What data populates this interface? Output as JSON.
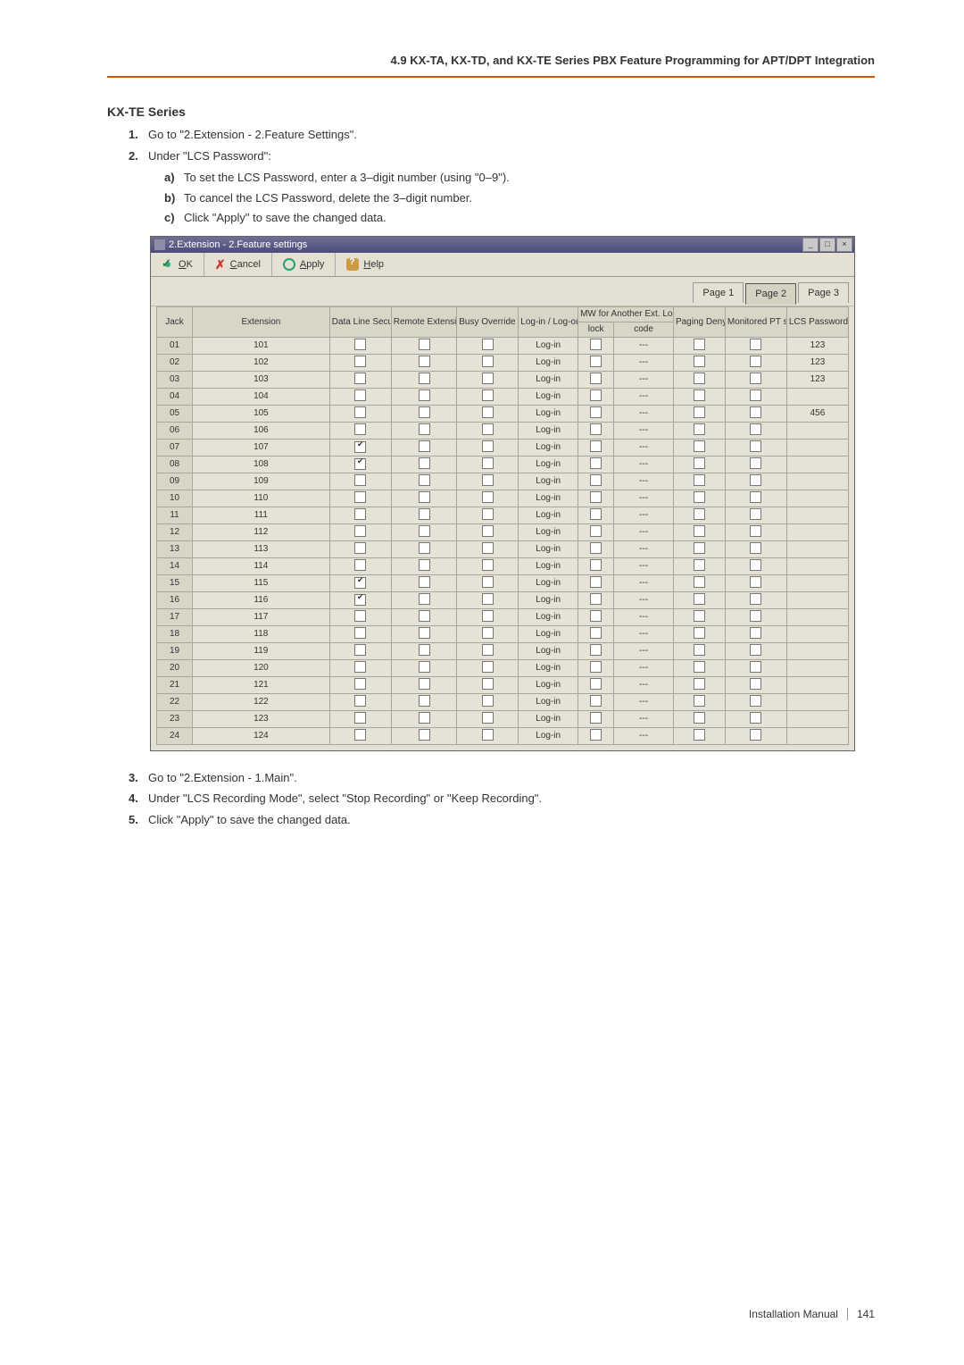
{
  "header": "4.9 KX-TA, KX-TD, and KX-TE Series PBX Feature Programming for APT/DPT Integration",
  "section_title": "KX-TE Series",
  "steps_top": [
    {
      "n": "1.",
      "t": "Go to \"2.Extension - 2.Feature Settings\"."
    },
    {
      "n": "2.",
      "t": "Under \"LCS Password\":"
    }
  ],
  "substeps": [
    {
      "n": "a)",
      "t": "To set the LCS Password, enter a 3–digit number (using \"0–9\")."
    },
    {
      "n": "b)",
      "t": "To cancel the LCS Password, delete the 3–digit number."
    },
    {
      "n": "c)",
      "t": "Click \"Apply\" to save the changed data."
    }
  ],
  "window": {
    "title": "2.Extension - 2.Feature settings",
    "toolbar": {
      "ok": "OK",
      "cancel": "Cancel",
      "apply": "Apply",
      "help": "Help",
      "ok_u": "O",
      "cancel_u": "C",
      "apply_u": "A",
      "help_u": "H"
    },
    "tabs": [
      "Page 1",
      "Page 2",
      "Page 3"
    ],
    "active_tab": 1,
    "columns": {
      "jack": "Jack",
      "ext": "Extension",
      "dls": "Data Line Security",
      "rel": "Remote Extension Lock",
      "bod": "Busy Override Deny",
      "login": "Log-in / Log-out",
      "mw": "MW for Another Ext. Lock",
      "mw_lock": "lock",
      "mw_code": "code",
      "pd": "Paging Deny",
      "mpt": "Monitored PT set",
      "lcs": "LCS Password"
    },
    "rows": [
      {
        "jack": "01",
        "ext": "101",
        "dls": false,
        "rel": false,
        "bod": false,
        "login": "Log-in",
        "mwl": false,
        "mwc": "---",
        "pd": false,
        "mpt": false,
        "lcs": "123"
      },
      {
        "jack": "02",
        "ext": "102",
        "dls": false,
        "rel": false,
        "bod": false,
        "login": "Log-in",
        "mwl": false,
        "mwc": "---",
        "pd": false,
        "mpt": false,
        "lcs": "123"
      },
      {
        "jack": "03",
        "ext": "103",
        "dls": false,
        "rel": false,
        "bod": false,
        "login": "Log-in",
        "mwl": false,
        "mwc": "---",
        "pd": false,
        "mpt": false,
        "lcs": "123"
      },
      {
        "jack": "04",
        "ext": "104",
        "dls": false,
        "rel": false,
        "bod": false,
        "login": "Log-in",
        "mwl": false,
        "mwc": "---",
        "pd": false,
        "mpt": false,
        "lcs": ""
      },
      {
        "jack": "05",
        "ext": "105",
        "dls": false,
        "rel": false,
        "bod": false,
        "login": "Log-in",
        "mwl": false,
        "mwc": "---",
        "pd": false,
        "mpt": false,
        "lcs": "456"
      },
      {
        "jack": "06",
        "ext": "106",
        "dls": false,
        "rel": false,
        "bod": false,
        "login": "Log-in",
        "mwl": false,
        "mwc": "---",
        "pd": false,
        "mpt": false,
        "lcs": ""
      },
      {
        "jack": "07",
        "ext": "107",
        "dls": true,
        "rel": false,
        "bod": false,
        "login": "Log-in",
        "mwl": false,
        "mwc": "---",
        "pd": false,
        "mpt": false,
        "lcs": ""
      },
      {
        "jack": "08",
        "ext": "108",
        "dls": true,
        "rel": false,
        "bod": false,
        "login": "Log-in",
        "mwl": false,
        "mwc": "---",
        "pd": false,
        "mpt": false,
        "lcs": ""
      },
      {
        "jack": "09",
        "ext": "109",
        "dls": false,
        "rel": false,
        "bod": false,
        "login": "Log-in",
        "mwl": false,
        "mwc": "---",
        "pd": false,
        "mpt": false,
        "lcs": ""
      },
      {
        "jack": "10",
        "ext": "110",
        "dls": false,
        "rel": false,
        "bod": false,
        "login": "Log-in",
        "mwl": false,
        "mwc": "---",
        "pd": false,
        "mpt": false,
        "lcs": ""
      },
      {
        "jack": "11",
        "ext": "111",
        "dls": false,
        "rel": false,
        "bod": false,
        "login": "Log-in",
        "mwl": false,
        "mwc": "---",
        "pd": false,
        "mpt": false,
        "lcs": ""
      },
      {
        "jack": "12",
        "ext": "112",
        "dls": false,
        "rel": false,
        "bod": false,
        "login": "Log-in",
        "mwl": false,
        "mwc": "---",
        "pd": false,
        "mpt": false,
        "lcs": ""
      },
      {
        "jack": "13",
        "ext": "113",
        "dls": false,
        "rel": false,
        "bod": false,
        "login": "Log-in",
        "mwl": false,
        "mwc": "---",
        "pd": false,
        "mpt": false,
        "lcs": ""
      },
      {
        "jack": "14",
        "ext": "114",
        "dls": false,
        "rel": false,
        "bod": false,
        "login": "Log-in",
        "mwl": false,
        "mwc": "---",
        "pd": false,
        "mpt": false,
        "lcs": ""
      },
      {
        "jack": "15",
        "ext": "115",
        "dls": true,
        "rel": false,
        "bod": false,
        "login": "Log-in",
        "mwl": false,
        "mwc": "---",
        "pd": false,
        "mpt": false,
        "lcs": ""
      },
      {
        "jack": "16",
        "ext": "116",
        "dls": true,
        "rel": false,
        "bod": false,
        "login": "Log-in",
        "mwl": false,
        "mwc": "---",
        "pd": false,
        "mpt": false,
        "lcs": ""
      },
      {
        "jack": "17",
        "ext": "117",
        "dls": false,
        "rel": false,
        "bod": false,
        "login": "Log-in",
        "mwl": false,
        "mwc": "---",
        "pd": false,
        "mpt": false,
        "lcs": ""
      },
      {
        "jack": "18",
        "ext": "118",
        "dls": false,
        "rel": false,
        "bod": false,
        "login": "Log-in",
        "mwl": false,
        "mwc": "---",
        "pd": false,
        "mpt": false,
        "lcs": ""
      },
      {
        "jack": "19",
        "ext": "119",
        "dls": false,
        "rel": false,
        "bod": false,
        "login": "Log-in",
        "mwl": false,
        "mwc": "---",
        "pd": false,
        "mpt": false,
        "lcs": ""
      },
      {
        "jack": "20",
        "ext": "120",
        "dls": false,
        "rel": false,
        "bod": false,
        "login": "Log-in",
        "mwl": false,
        "mwc": "---",
        "pd": false,
        "mpt": false,
        "lcs": ""
      },
      {
        "jack": "21",
        "ext": "121",
        "dls": false,
        "rel": false,
        "bod": false,
        "login": "Log-in",
        "mwl": false,
        "mwc": "---",
        "pd": false,
        "mpt": false,
        "lcs": ""
      },
      {
        "jack": "22",
        "ext": "122",
        "dls": false,
        "rel": false,
        "bod": false,
        "login": "Log-in",
        "mwl": false,
        "mwc": "---",
        "pd": false,
        "mpt": false,
        "lcs": ""
      },
      {
        "jack": "23",
        "ext": "123",
        "dls": false,
        "rel": false,
        "bod": false,
        "login": "Log-in",
        "mwl": false,
        "mwc": "---",
        "pd": false,
        "mpt": false,
        "lcs": ""
      },
      {
        "jack": "24",
        "ext": "124",
        "dls": false,
        "rel": false,
        "bod": false,
        "login": "Log-in",
        "mwl": false,
        "mwc": "---",
        "pd": false,
        "mpt": false,
        "lcs": ""
      }
    ]
  },
  "steps_bottom": [
    {
      "n": "3.",
      "t": "Go to \"2.Extension - 1.Main\"."
    },
    {
      "n": "4.",
      "t": "Under \"LCS Recording Mode\", select \"Stop Recording\" or \"Keep Recording\"."
    },
    {
      "n": "5.",
      "t": "Click \"Apply\" to save the changed data."
    }
  ],
  "footer": {
    "label": "Installation Manual",
    "page": "141"
  }
}
